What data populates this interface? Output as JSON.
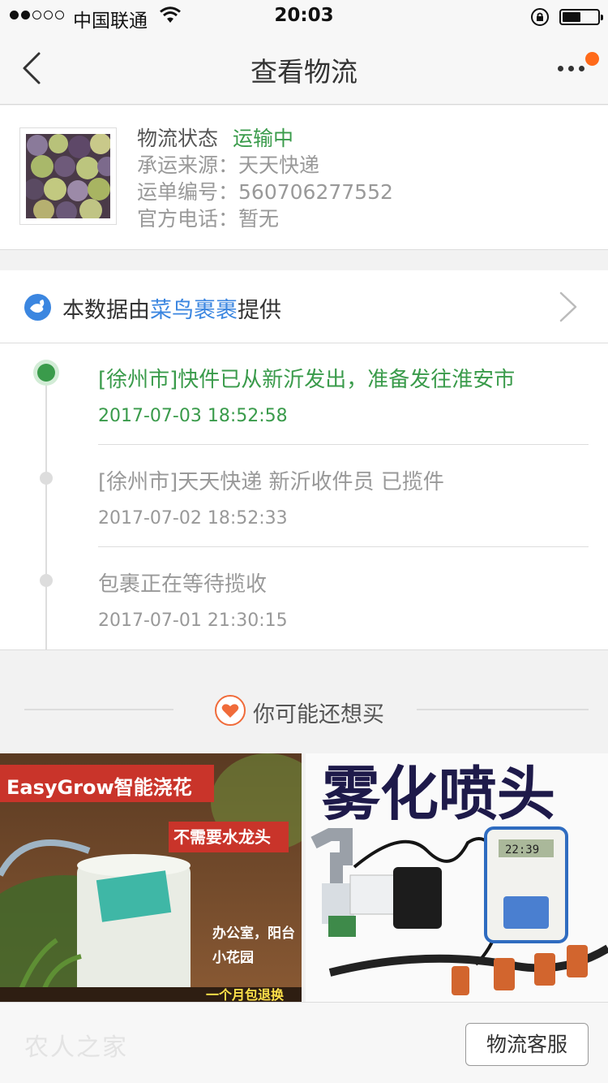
{
  "status_bar": {
    "carrier": "中国联通",
    "time": "20:03"
  },
  "nav": {
    "title": "查看物流"
  },
  "shipment": {
    "status_label": "物流状态",
    "status_value": "运输中",
    "carrier_label": "承运来源：",
    "carrier_value": "天天快递",
    "tracking_label": "运单编号：",
    "tracking_value": "560706277552",
    "phone_label": "官方电话：",
    "phone_value": "暂无"
  },
  "provider": {
    "prefix": "本数据由",
    "name": "菜鸟裹裹",
    "suffix": "提供"
  },
  "timeline": [
    {
      "text": "[徐州市]快件已从新沂发出，准备发往淮安市",
      "time": "2017-07-03 18:52:58"
    },
    {
      "text": "[徐州市]天天快递 新沂收件员 已揽件",
      "time": "2017-07-02 18:52:33"
    },
    {
      "text": "包裹正在等待揽收",
      "time": "2017-07-01 21:30:15"
    }
  ],
  "recommend": {
    "title": "你可能还想买",
    "products": [
      {
        "banner": "EasyGrow智能浇花",
        "tag": "不需要水龙头",
        "line1": "办公室，阳台",
        "line2": "小花园",
        "footer": "一个月包退换"
      },
      {
        "headline": "雾化喷头",
        "timer_display": "22:39"
      }
    ]
  },
  "footer": {
    "watermark": "农人之家",
    "service_button": "物流客服"
  },
  "colors": {
    "accent_green": "#3a9b4b",
    "link_blue": "#3b86e0",
    "notify_orange": "#ff6a1a"
  }
}
